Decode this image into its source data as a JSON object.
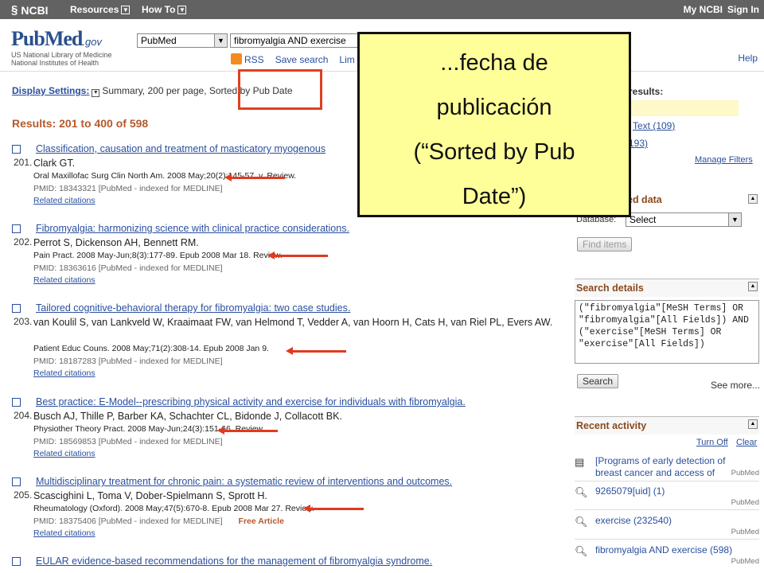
{
  "topbar": {
    "brand": "NCBI",
    "resources": "Resources",
    "howto": "How To",
    "myncbi": "My NCBI",
    "signin": "Sign In"
  },
  "header": {
    "logo_pub": "Pub",
    "logo_med": "Med",
    "logo_gov": ".gov",
    "logo_sub1": "US National Library of Medicine",
    "logo_sub2": "National Institutes of Health",
    "db_value": "PubMed",
    "search_value": "fibromyalgia AND exercise",
    "rss": "RSS",
    "save_search": "Save search",
    "limits": "Lim",
    "help": "Help"
  },
  "display": {
    "label": "Display Settings:",
    "value": "Summary, 200 per page, Sorted by Pub Date"
  },
  "results_header": "Results: 201 to 400 of 598",
  "callout": {
    "line1": "...fecha de",
    "line2": "publicación",
    "line3": "(“Sorted by Pub",
    "line4": "Date”)"
  },
  "results": [
    {
      "num": "201.",
      "title": "Classification, causation and treatment of masticatory myogenous",
      "authors": "Clark GT.",
      "journal": "Oral Maxillofac Surg Clin North Am. 2008 May;20(2):145-57, v. Review.",
      "pmid": "PMID: 18343321 [PubMed - indexed for MEDLINE]",
      "related": "Related citations",
      "free": ""
    },
    {
      "num": "202.",
      "title": "Fibromyalgia: harmonizing science with clinical practice considerations.",
      "authors": "Perrot S, Dickenson AH, Bennett RM.",
      "journal": "Pain Pract. 2008 May-Jun;8(3):177-89. Epub 2008 Mar 18. Review.",
      "pmid": "PMID: 18363616 [PubMed - indexed for MEDLINE]",
      "related": "Related citations",
      "free": ""
    },
    {
      "num": "203.",
      "title": "Tailored cognitive-behavioral therapy for fibromyalgia: two case studies.",
      "authors": "van Koulil S, van Lankveld W, Kraaimaat FW, van Helmond T, Vedder A, van Hoorn H, Cats H, van Riel PL, Evers AW.",
      "journal": "Patient Educ Couns. 2008 May;71(2):308-14. Epub 2008 Jan 9.",
      "pmid": "PMID: 18187283 [PubMed - indexed for MEDLINE]",
      "related": "Related citations",
      "free": ""
    },
    {
      "num": "204.",
      "title": "Best practice: E-Model--prescribing physical activity and exercise for individuals with fibromyalgia.",
      "authors": "Busch AJ, Thille P, Barber KA, Schachter CL, Bidonde J, Collacott BK.",
      "journal": "Physiother Theory Pract. 2008 May-Jun;24(3):151-66. Review.",
      "pmid": "PMID: 18569853 [PubMed - indexed for MEDLINE]",
      "related": "Related citations",
      "free": ""
    },
    {
      "num": "205.",
      "title": "Multidisciplinary treatment for chronic pain: a systematic review of interventions and outcomes.",
      "authors": "Scascighini L, Toma V, Dober-Spielmann S, Sprott H.",
      "journal": "Rheumatology (Oxford). 2008 May;47(5):670-8. Epub 2008 Mar 27. Review.",
      "pmid": "PMID: 18375406 [PubMed - indexed for MEDLINE]",
      "related": "Related citations",
      "free": "Free Article"
    },
    {
      "num": "206.",
      "title": "EULAR evidence-based recommendations for the management of fibromyalgia syndrome.",
      "authors": "",
      "journal": "",
      "pmid": "",
      "related": "",
      "free": ""
    }
  ],
  "sidebar": {
    "filter_title": "results:",
    "filter_text": "Text (109)",
    "filter_count2": "193)",
    "manage_filters": "Manage Filters",
    "related_title": "ed data",
    "db_label": "Database:",
    "db_select": "Select",
    "find_items": "Find items",
    "details_title": "Search details",
    "details_text": "(\"fibromyalgia\"[MeSH Terms] OR \"fibromyalgia\"[All Fields]) AND (\"exercise\"[MeSH Terms] OR \"exercise\"[All Fields])",
    "search_btn": "Search",
    "see_more": "See more...",
    "recent_title": "Recent activity",
    "turn_off": "Turn Off",
    "clear": "Clear",
    "activity": [
      {
        "text": "[Programs of early detection of breast cancer and access of",
        "src": "PubMed",
        "icon": "document-icon"
      },
      {
        "text": "9265079[uid] (1)",
        "src": "PubMed",
        "icon": "search-icon"
      },
      {
        "text": "exercise (232540)",
        "src": "PubMed",
        "icon": "search-icon"
      },
      {
        "text": "fibromyalgia AND exercise (598)",
        "src": "PubMed",
        "icon": "search-icon"
      }
    ]
  }
}
